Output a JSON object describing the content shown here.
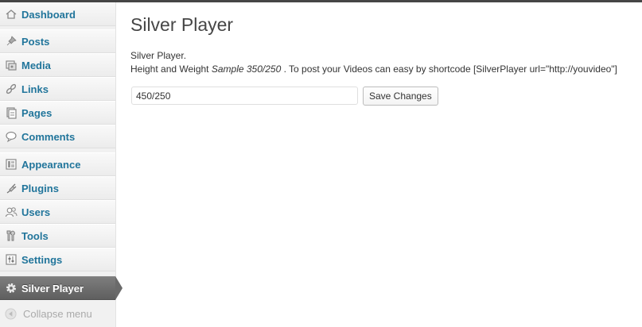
{
  "sidebar": {
    "items": [
      {
        "label": "Dashboard",
        "icon": "dashboard-icon"
      },
      {
        "label": "Posts",
        "icon": "pin-icon"
      },
      {
        "label": "Media",
        "icon": "media-icon"
      },
      {
        "label": "Links",
        "icon": "link-icon"
      },
      {
        "label": "Pages",
        "icon": "pages-icon"
      },
      {
        "label": "Comments",
        "icon": "comment-icon"
      },
      {
        "label": "Appearance",
        "icon": "appearance-icon"
      },
      {
        "label": "Plugins",
        "icon": "plug-icon"
      },
      {
        "label": "Users",
        "icon": "users-icon"
      },
      {
        "label": "Tools",
        "icon": "tools-icon"
      },
      {
        "label": "Settings",
        "icon": "settings-icon"
      },
      {
        "label": "Silver Player",
        "icon": "gear-icon",
        "active": true
      }
    ],
    "collapse_label": "Collapse menu"
  },
  "main": {
    "title": "Silver Player",
    "description_line1": "Silver Player.",
    "description_prefix": "Height and Weight ",
    "description_sample": "Sample 350/250",
    "description_suffix": " . To post your Videos can easy by shortcode [SilverPlayer url=\"http://youvideo\"]",
    "size_value": "450/250",
    "save_label": "Save Changes"
  },
  "colors": {
    "link": "#21759b",
    "active_bg": "#6a6a6a",
    "sidebar_bg": "#f1f1f1"
  }
}
